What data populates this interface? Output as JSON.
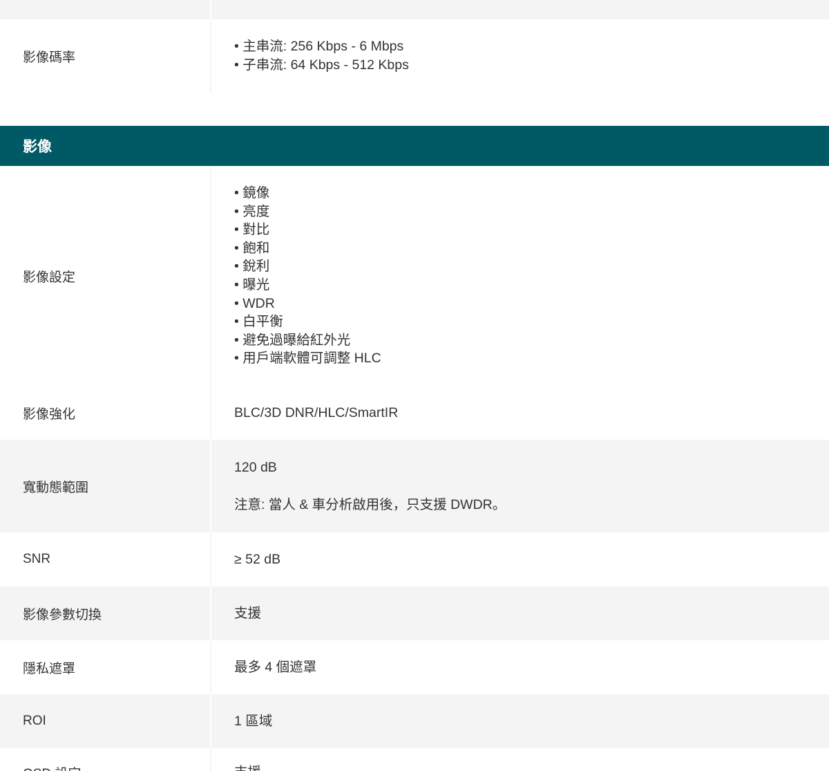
{
  "prev_section": {
    "bitrate": {
      "label": "影像碼率",
      "items": [
        "主串流: 256 Kbps - 6 Mbps",
        "子串流: 64 Kbps - 512 Kbps"
      ]
    }
  },
  "section": {
    "title": "影像",
    "rows": {
      "image_settings": {
        "label": "影像設定",
        "items": [
          "鏡像",
          "亮度",
          "對比",
          "飽和",
          "銳利",
          "曝光",
          "WDR",
          "白平衡",
          "避免過曝給紅外光",
          "用戶端軟體可調整 HLC"
        ]
      },
      "enhancement": {
        "label": "影像強化",
        "value": "BLC/3D DNR/HLC/SmartIR"
      },
      "wdr": {
        "label": "寬動態範圍",
        "value": "120 dB",
        "note": "注意: 當人 & 車分析啟用後，只支援 DWDR。"
      },
      "snr": {
        "label": "SNR",
        "value": "≥ 52 dB"
      },
      "param_switch": {
        "label": "影像參數切換",
        "value": "支援"
      },
      "privacy_mask": {
        "label": "隱私遮罩",
        "value": "最多 4 個遮罩"
      },
      "roi": {
        "label": "ROI",
        "value": "1 區域"
      },
      "osd": {
        "label": "OSD 設定",
        "value": "支援"
      }
    }
  }
}
